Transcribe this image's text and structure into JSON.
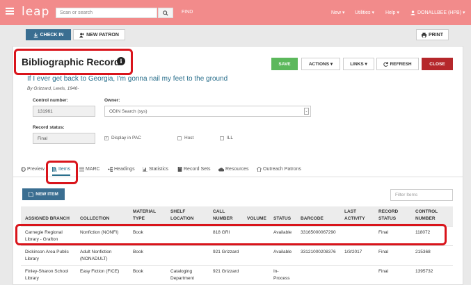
{
  "nav": {
    "logo": "leap",
    "search_placeholder": "Scan or search",
    "find": "FIND",
    "new": "New ▾",
    "utilities": "Utilities ▾",
    "help": "Help ▾",
    "user": "DONALLBEE (HPB) ▾"
  },
  "toolbar": {
    "checkin": "CHECK IN",
    "new_patron": "NEW PATRON",
    "print": "PRINT"
  },
  "record": {
    "heading": "Bibliographic Record",
    "save": "SAVE",
    "actions": "ACTIONS ▾",
    "links": "LINKS ▾",
    "refresh": "REFRESH",
    "close": "CLOSE",
    "title": "If I ever get back to Georgia, I'm gonna nail my feet to the ground",
    "author": "By Grizzard, Lewis, 1946-",
    "control_label": "Control number:",
    "control_value": "131961",
    "owner_label": "Owner:",
    "owner_value": "ODIN Search (sys)",
    "status_label": "Record status:",
    "status_value": "Final",
    "display_pac": "Display in PAC",
    "host": "Host",
    "ill": "ILL"
  },
  "tabs": [
    "Preview",
    "Items",
    "MARC",
    "Headings",
    "Statistics",
    "Record Sets",
    "Resources",
    "Outreach Patrons"
  ],
  "items": {
    "new_item": "NEW ITEM",
    "filter_placeholder": "Filter Items",
    "columns": [
      [
        "ASSIGNED BRANCH"
      ],
      [
        "COLLECTION"
      ],
      [
        "MATERIAL",
        "TYPE"
      ],
      [
        "SHELF",
        "LOCATION"
      ],
      [
        "CALL",
        "NUMBER"
      ],
      [
        "VOLUME"
      ],
      [
        "STATUS"
      ],
      [
        "BARCODE"
      ],
      [
        "LAST",
        "ACTIVITY"
      ],
      [
        "RECORD",
        "STATUS"
      ],
      [
        "CONTROL",
        "NUMBER"
      ]
    ],
    "rows": [
      [
        [
          "Carnegie Regional",
          "Library - Grafton"
        ],
        [
          "Nonfiction (NONFI)"
        ],
        [
          "Book"
        ],
        [
          ""
        ],
        [
          "818 GRI"
        ],
        [
          ""
        ],
        [
          "Available"
        ],
        [
          "33165000067290"
        ],
        [
          ""
        ],
        [
          "Final"
        ],
        [
          "118072"
        ]
      ],
      [
        [
          "Dickinson Area Public",
          "Library"
        ],
        [
          "Adult Nonfiction",
          "(NONADULT)"
        ],
        [
          "Book"
        ],
        [
          ""
        ],
        [
          "921 Grizzard"
        ],
        [
          ""
        ],
        [
          "Available"
        ],
        [
          "33121000208376"
        ],
        [
          "1/3/2017"
        ],
        [
          "Final"
        ],
        [
          "215368"
        ]
      ],
      [
        [
          "Finley-Sharon School",
          "Library"
        ],
        [
          "Easy Fiction (FICE)"
        ],
        [
          "Book"
        ],
        [
          "Cataloging",
          "Department"
        ],
        [
          "921 Grizzard"
        ],
        [
          ""
        ],
        [
          "In-",
          "Process"
        ],
        [
          ""
        ],
        [
          ""
        ],
        [
          "Final"
        ],
        [
          "1395732"
        ]
      ]
    ]
  },
  "colors": {
    "nav_bg": "#f28b8b",
    "primary": "#3a6e91",
    "save": "#5cb85c",
    "close": "#b5272b",
    "highlight": "#d9141b",
    "link": "#2a6f8c"
  }
}
